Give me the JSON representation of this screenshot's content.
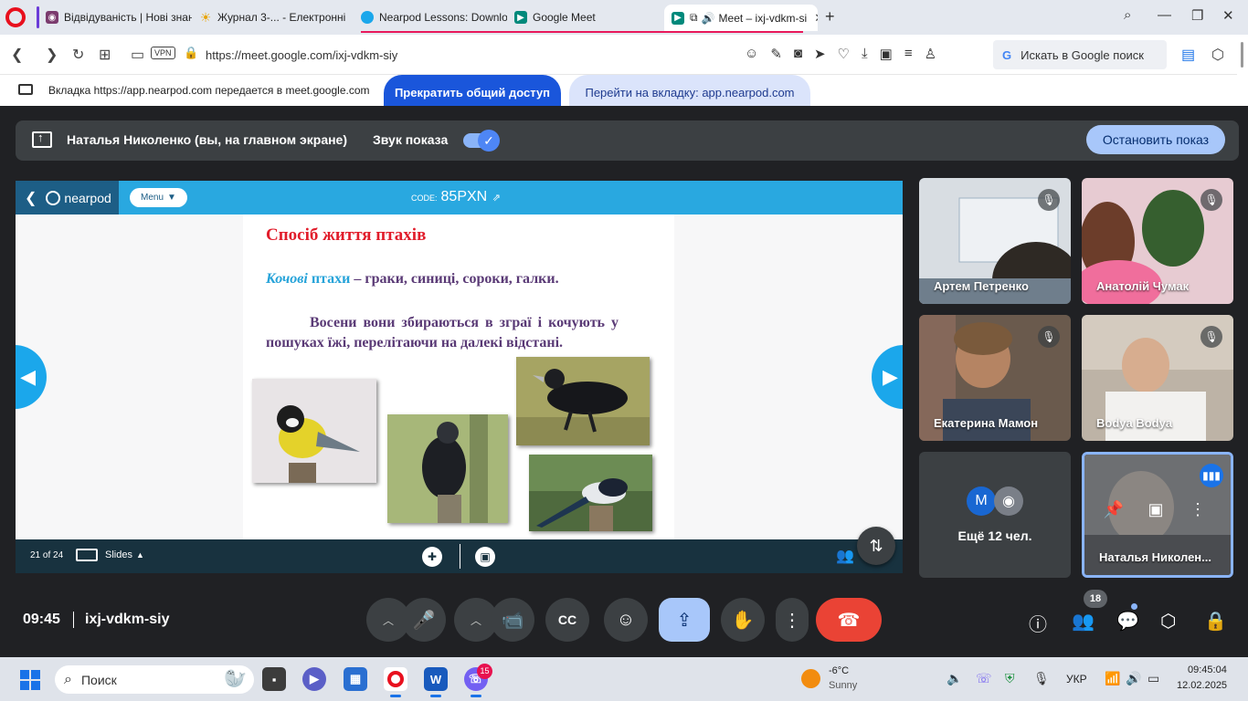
{
  "browser": {
    "tabs": [
      {
        "title": "Відвідуваність | Нові знан"
      },
      {
        "title": "Журнал 3-... - Електронні"
      },
      {
        "title": "Nearpod Lessons: Downlo"
      },
      {
        "title": "Google Meet"
      },
      {
        "title": "Meet – ixj-vdkm-si",
        "active": true
      }
    ],
    "url": "https://meet.google.com/ixj-vdkm-siy",
    "vpn_label": "VPN",
    "search_placeholder": "Искать в Google поиск"
  },
  "share_bar": {
    "message": "Вкладка https://app.nearpod.com передается в meet.google.com",
    "stop_label": "Прекратить общий доступ",
    "goto_label": "Перейти на вкладку: app.nearpod.com"
  },
  "presenting_banner": {
    "name": "Наталья Николенко (вы, на главном экране)",
    "sound_label": "Звук показа",
    "stop_label": "Остановить показ"
  },
  "nearpod": {
    "logo": "nearpod",
    "menu_label": "Menu",
    "code_label": "CODE:",
    "code": "85PXN",
    "slide_counter": "21 of 24",
    "slides_label": "Slides",
    "slide": {
      "title": "Спосіб життя птахів",
      "line1_highlight_italic": "Кочові",
      "line1_highlight": " птахи",
      "line1_rest": " – граки, синиці, сороки, галки.",
      "paragraph": "Восени вони збираються в зграї і кочують у пошуках їжі, перелітаючи на далекі відстані."
    }
  },
  "participants": [
    {
      "name": "Артем Петренко",
      "muted": true
    },
    {
      "name": "Анатолій Чумак",
      "muted": true
    },
    {
      "name": "Екатерина Мамон",
      "muted": true
    },
    {
      "name": "Bodya Bodya",
      "muted": true
    }
  ],
  "more_tile": {
    "label": "Ещё 12 чел.",
    "avatar_letter": "M"
  },
  "self_tile": {
    "name": "Наталья Николен..."
  },
  "controls": {
    "time": "09:45",
    "meeting_code": "ixj-vdkm-siy",
    "participants_count": "18"
  },
  "taskbar": {
    "search_label": "Поиск",
    "badge_count": "15",
    "weather_temp": "-6°C",
    "weather_desc": "Sunny",
    "lang": "УКР",
    "clock_time": "09:45:04",
    "clock_date": "12.02.2025"
  },
  "colors": {
    "meet_bg": "#202124",
    "nearpod_blue": "#29a8e0",
    "stop_share_blue": "#1a56db",
    "hangup_red": "#ea4335"
  }
}
